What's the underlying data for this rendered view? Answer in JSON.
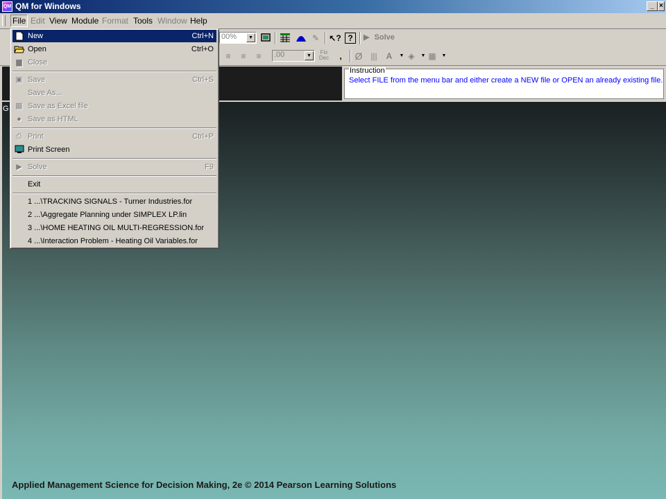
{
  "window": {
    "title": "QM for Windows",
    "minimize_glyph": "_",
    "close_glyph": "×"
  },
  "menubar": {
    "file": "File",
    "edit": "Edit",
    "view": "View",
    "module": "Module",
    "format": "Format",
    "tools": "Tools",
    "window": "Window",
    "help": "Help"
  },
  "toolbar": {
    "zoom_value": "00%",
    "decimal_value": ".00",
    "solve_label": "Solve",
    "fixdec_label": "Fix Dec",
    "comma_label": ","
  },
  "instruction": {
    "label": "Instruction",
    "text": "Select FILE from the menu bar and either create a NEW file or OPEN an already existing file."
  },
  "main": {
    "fragment": "G",
    "footer": "Applied Management Science for Decision Making, 2e © 2014 Pearson Learning Solutions"
  },
  "file_menu": {
    "new": {
      "label": "New",
      "shortcut": "Ctrl+N"
    },
    "open": {
      "label": "Open",
      "shortcut": "Ctrl+O"
    },
    "close": {
      "label": "Close"
    },
    "save": {
      "label": "Save",
      "shortcut": "Ctrl+S"
    },
    "save_as": {
      "label": "Save As..."
    },
    "save_excel": {
      "label": "Save as Excel file"
    },
    "save_html": {
      "label": "Save as HTML"
    },
    "print": {
      "label": "Print",
      "shortcut": "Ctrl+P"
    },
    "print_screen": {
      "label": "Print Screen"
    },
    "solve": {
      "label": "Solve",
      "shortcut": "F9"
    },
    "exit": {
      "label": "Exit"
    },
    "recent": [
      "1 ...\\TRACKING SIGNALS - Turner Industries.for",
      "2 ...\\Aggregate Planning under SIMPLEX LP.lin",
      "3 ...\\HOME HEATING OIL MULTI-REGRESSION.for",
      "4 ...\\Interaction Problem - Heating Oil Variables.for"
    ]
  },
  "colors": {
    "highlight": "#0a246a",
    "instruction_text": "#0000ff",
    "face": "#d4d0c8"
  }
}
